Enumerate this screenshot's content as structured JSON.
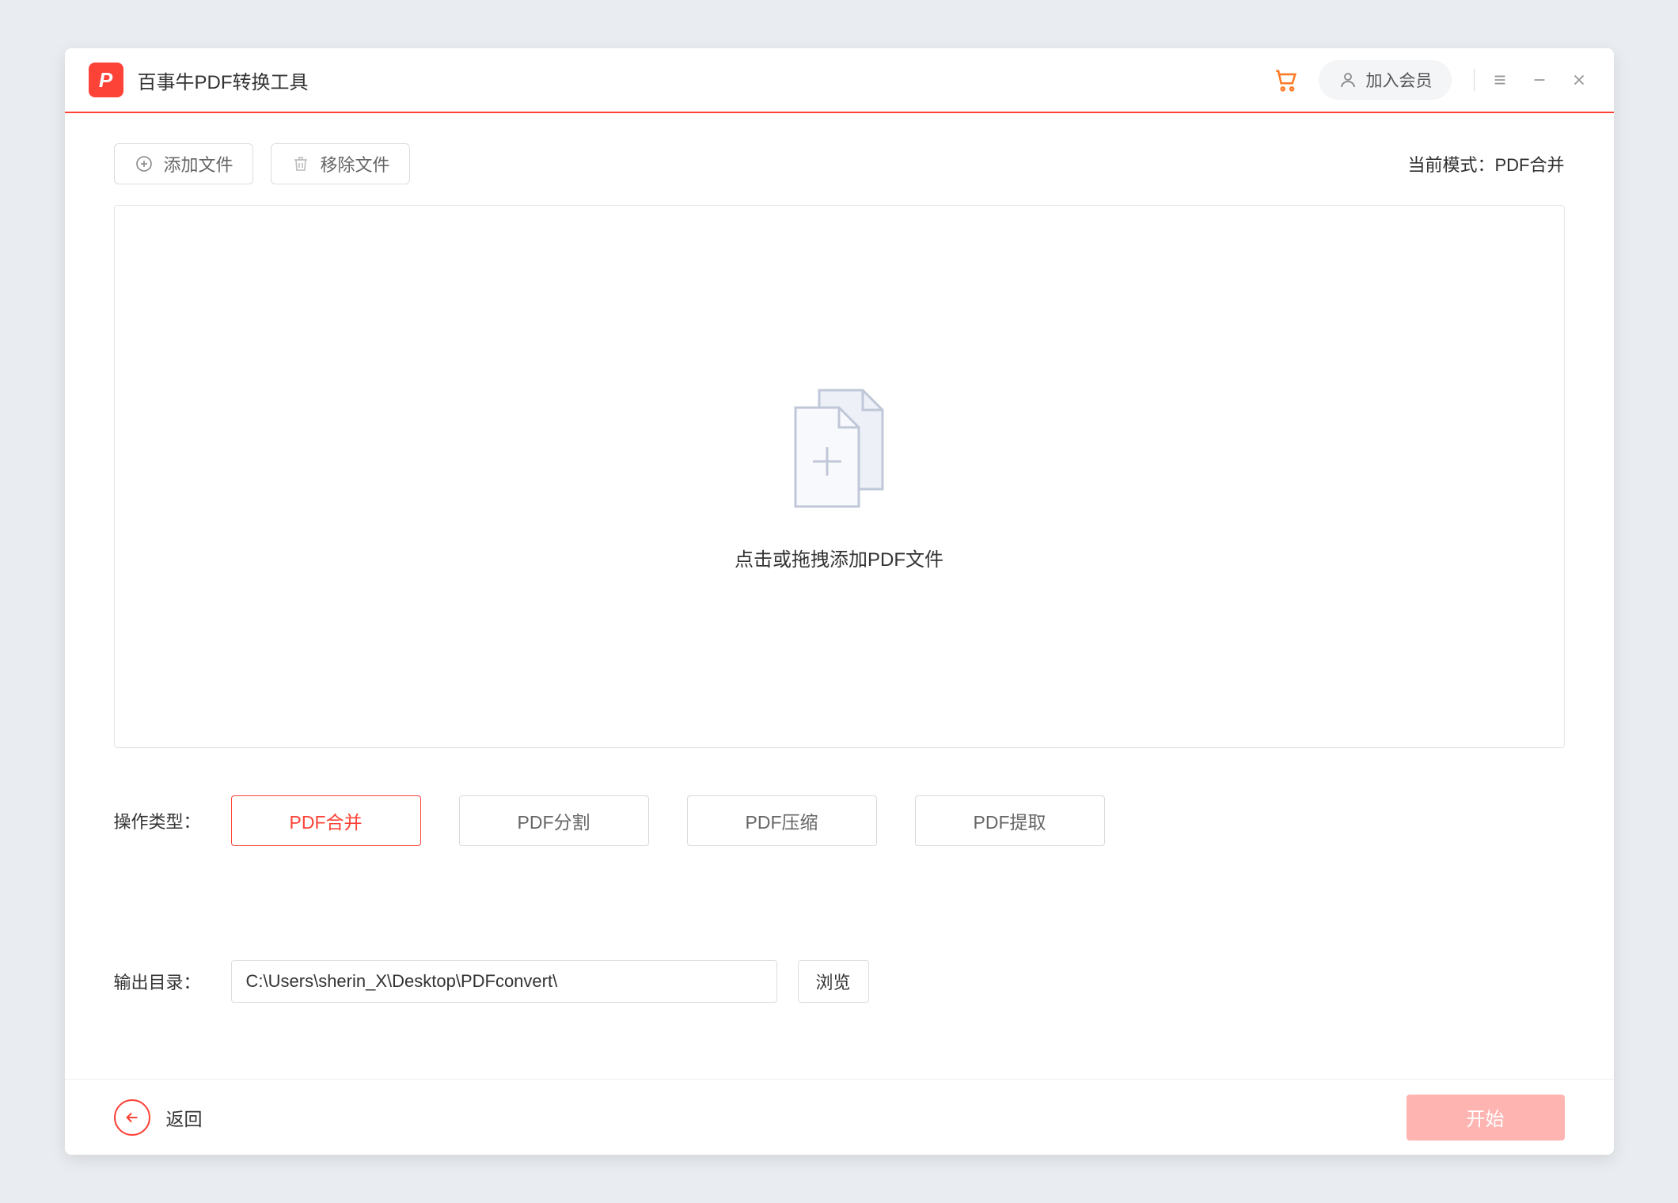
{
  "header": {
    "app_title": "百事牛PDF转换工具",
    "member_label": "加入会员"
  },
  "toolbar": {
    "add_file_label": "添加文件",
    "remove_file_label": "移除文件",
    "mode_prefix": "当前模式：",
    "mode_value": "PDF合并"
  },
  "dropzone": {
    "hint": "点击或拖拽添加PDF文件"
  },
  "options": {
    "label": "操作类型：",
    "items": [
      {
        "label": "PDF合并",
        "active": true
      },
      {
        "label": "PDF分割",
        "active": false
      },
      {
        "label": "PDF压缩",
        "active": false
      },
      {
        "label": "PDF提取",
        "active": false
      }
    ]
  },
  "output": {
    "label": "输出目录：",
    "path": "C:\\Users\\sherin_X\\Desktop\\PDFconvert\\",
    "browse_label": "浏览"
  },
  "footer": {
    "back_label": "返回",
    "start_label": "开始"
  },
  "colors": {
    "accent": "#fd4238",
    "start_disabled": "#feb4b0"
  }
}
